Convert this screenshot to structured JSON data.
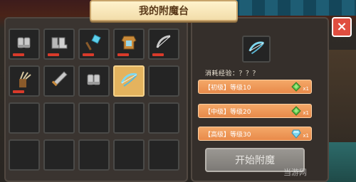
{
  "title": "我的附魔台",
  "close_label": "×",
  "inventory": {
    "rows": [
      [
        {
          "icon": "gauntlet-icon",
          "has_bar": true,
          "selected": false
        },
        {
          "icon": "boots-icon",
          "has_bar": true,
          "selected": false
        },
        {
          "icon": "shovel-icon",
          "has_bar": true,
          "selected": false
        },
        {
          "icon": "chestplate-icon",
          "has_bar": true,
          "selected": false
        },
        {
          "icon": "bow-icon",
          "has_bar": true,
          "selected": false
        }
      ],
      [
        {
          "icon": "arrows-icon",
          "has_bar": true,
          "selected": false
        },
        {
          "icon": "sword-icon",
          "has_bar": false,
          "selected": false
        },
        {
          "icon": "gauntlet-icon",
          "has_bar": false,
          "selected": false
        },
        {
          "icon": "crossbow-icon",
          "has_bar": false,
          "selected": true
        },
        {
          "icon": "",
          "has_bar": false,
          "selected": false
        }
      ],
      [
        {
          "icon": "",
          "has_bar": false,
          "selected": false
        },
        {
          "icon": "",
          "has_bar": false,
          "selected": false
        },
        {
          "icon": "",
          "has_bar": false,
          "selected": false
        },
        {
          "icon": "",
          "has_bar": false,
          "selected": false
        },
        {
          "icon": "",
          "has_bar": false,
          "selected": false
        }
      ],
      [
        {
          "icon": "",
          "has_bar": false,
          "selected": false
        },
        {
          "icon": "",
          "has_bar": false,
          "selected": false
        },
        {
          "icon": "",
          "has_bar": false,
          "selected": false
        },
        {
          "icon": "",
          "has_bar": false,
          "selected": false
        },
        {
          "icon": "",
          "has_bar": false,
          "selected": false
        }
      ]
    ]
  },
  "detail": {
    "preview_icon": "crossbow-icon",
    "exp_label": "消耗经验：？？？",
    "options": [
      {
        "label": "【初级】等级10",
        "gem": "green-gem-icon",
        "qty": "x1"
      },
      {
        "label": "【中级】等级20",
        "gem": "green-gem-icon",
        "qty": "x1"
      },
      {
        "label": "【高级】等级30",
        "gem": "diamond-icon",
        "qty": "x1"
      }
    ],
    "start_label": "开始附魔"
  },
  "watermark": "当游网",
  "colors": {
    "close": "#e04e40",
    "selected_slot": "#e4b35e",
    "option": "#e88a4a",
    "durability": "#d93a2a",
    "start_button": "#8a8783"
  }
}
